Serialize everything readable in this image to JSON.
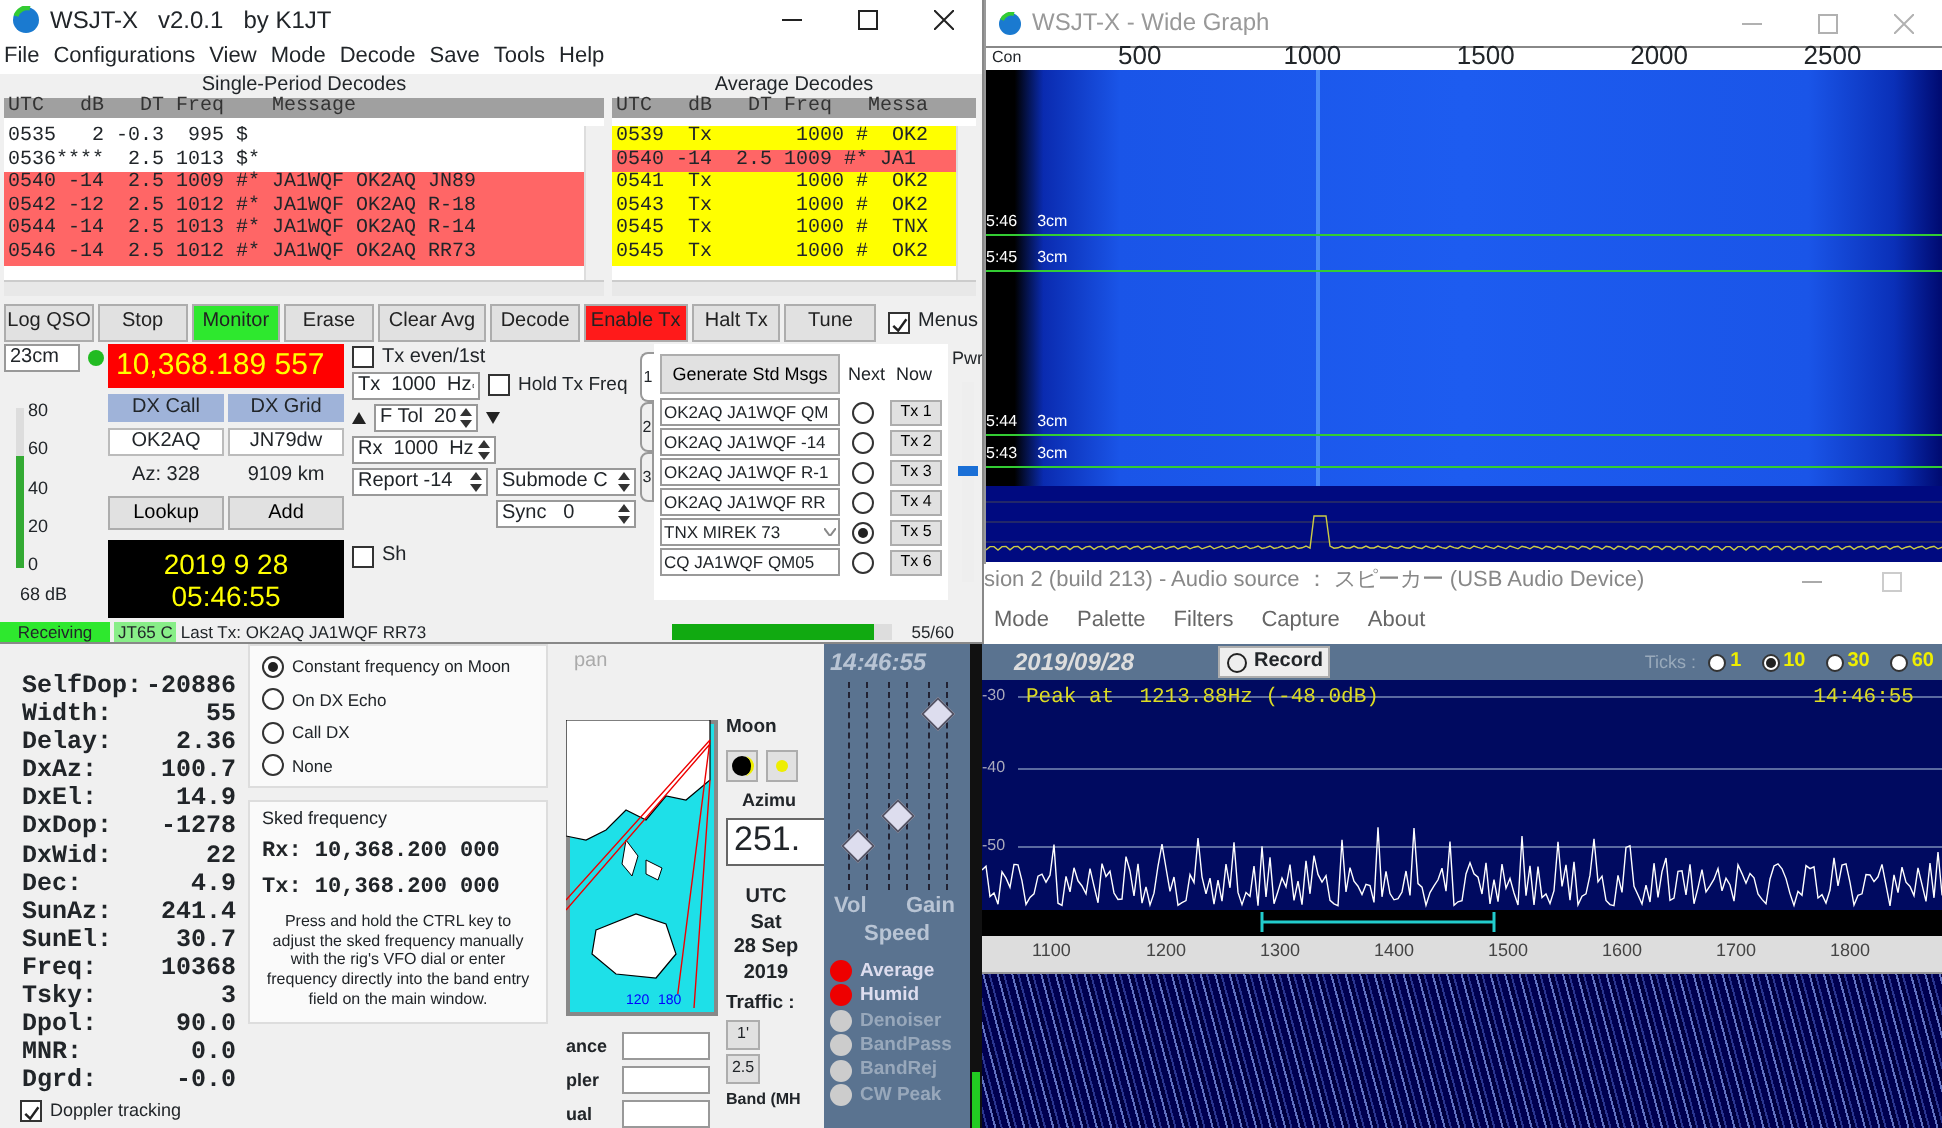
{
  "main_window": {
    "title": "WSJT-X   v2.0.1   by K1JT",
    "menu": [
      "File",
      "Configurations",
      "View",
      "Mode",
      "Decode",
      "Save",
      "Tools",
      "Help"
    ],
    "single_period": {
      "heading": "Single-Period Decodes",
      "header": "UTC   dB   DT Freq    Message",
      "rows": [
        {
          "text": "0535   2 -0.3  995 $",
          "color": "#ffffff"
        },
        {
          "text": "0536****  2.5 1013 $*",
          "color": "#ffffff"
        },
        {
          "text": "0540 -14  2.5 1009 #* JA1WQF OK2AQ JN89",
          "color": "#ff6666"
        },
        {
          "text": "0542 -12  2.5 1012 #* JA1WQF OK2AQ R-18",
          "color": "#ff6666"
        },
        {
          "text": "0544 -14  2.5 1013 #* JA1WQF OK2AQ R-14",
          "color": "#ff6666"
        },
        {
          "text": "0546 -14  2.5 1012 #* JA1WQF OK2AQ RR73",
          "color": "#ff6666"
        }
      ]
    },
    "average": {
      "heading": "Average Decodes",
      "header": "UTC   dB   DT Freq   Messa",
      "rows": [
        {
          "text": "0539  Tx       1000 #  OK2",
          "color": "#ffff00"
        },
        {
          "text": "0540 -14  2.5 1009 #* JA1",
          "color": "#ff6666"
        },
        {
          "text": "0541  Tx       1000 #  OK2",
          "color": "#ffff00"
        },
        {
          "text": "0543  Tx       1000 #  OK2",
          "color": "#ffff00"
        },
        {
          "text": "0545  Tx       1000 #  TNX",
          "color": "#ffff00"
        },
        {
          "text": "0545  Tx       1000 #  OK2",
          "color": "#ffff00"
        }
      ]
    },
    "buttons": [
      {
        "label": "Log QSO",
        "on": false
      },
      {
        "label": "Stop",
        "on": false
      },
      {
        "label": "Monitor",
        "on": true,
        "color": "#2ee82e"
      },
      {
        "label": "Erase",
        "on": false
      },
      {
        "label": "Clear Avg",
        "on": false
      },
      {
        "label": "Decode",
        "on": false
      },
      {
        "label": "Enable Tx",
        "on": true,
        "color": "#ff1a1a"
      },
      {
        "label": "Halt Tx",
        "on": false
      },
      {
        "label": "Tune",
        "on": false
      }
    ],
    "menus_toggle": {
      "label": "Menus",
      "checked": true
    },
    "band": "23cm",
    "frequency": "10,368.189 557",
    "meter": {
      "labels": [
        "80",
        "60",
        "40",
        "20",
        "0"
      ],
      "level": 0.7,
      "reading": "68 dB"
    },
    "dx_call_label": "DX Call",
    "dx_grid_label": "DX Grid",
    "dx_call": "OK2AQ",
    "dx_grid": "JN79dw",
    "azimuth": "Az: 328",
    "distance": "9109 km",
    "lookup": "Lookup",
    "add": "Add",
    "date": "2019 9 28",
    "time": "05:46:55",
    "tx_even": {
      "label": "Tx even/1st",
      "checked": false
    },
    "tx_spin": "Tx  1000  Hz",
    "hold_tx": {
      "label": "Hold Tx Freq",
      "checked": false
    },
    "ftol_spin": "F Tol  20",
    "rx_spin": "Rx  1000  Hz",
    "report_spin": "Report -14",
    "submode_spin": "Submode C",
    "sync_spin": "Sync   0",
    "sh": {
      "label": "Sh",
      "checked": false
    },
    "tabs": [
      {
        "label": "1",
        "selected": true
      },
      {
        "label": "2",
        "selected": false
      },
      {
        "label": "3",
        "selected": false
      }
    ],
    "generate": "Generate Std Msgs",
    "next_label": "Next",
    "now_label": "Now",
    "messages": [
      {
        "text": "OK2AQ JA1WQF QM",
        "kind": "field",
        "selected": false,
        "button": "Tx 1"
      },
      {
        "text": "OK2AQ JA1WQF -14",
        "kind": "field",
        "selected": false,
        "button": "Tx 2"
      },
      {
        "text": "OK2AQ JA1WQF R-1",
        "kind": "field",
        "selected": false,
        "button": "Tx 3"
      },
      {
        "text": "OK2AQ JA1WQF RR",
        "kind": "field",
        "selected": false,
        "button": "Tx 4"
      },
      {
        "text": "TNX MIREK 73",
        "kind": "combo",
        "selected": true,
        "button": "Tx 5"
      },
      {
        "text": "CQ JA1WQF QM05",
        "kind": "field",
        "selected": false,
        "button": "Tx 6"
      }
    ],
    "power": {
      "label": "Pwr",
      "level": 0.55
    },
    "status": {
      "state": "Receiving",
      "mode": "JT65 C",
      "last_tx": "Last Tx: OK2AQ JA1WQF RR73",
      "level": 0.917,
      "progress": "55/60"
    }
  },
  "wide_graph": {
    "title": "WSJT-X - Wide Graph",
    "scale_label": "Con",
    "ticks": [
      "500",
      "1000",
      "1500",
      "2000",
      "2500"
    ],
    "time_marks": [
      {
        "time": "5:46",
        "band": "3cm"
      },
      {
        "time": "5:45",
        "band": "3cm"
      },
      {
        "time": "5:44",
        "band": "3cm"
      },
      {
        "time": "5:43",
        "band": "3cm"
      }
    ]
  },
  "astro": {
    "rows": [
      {
        "label": "SelfDop:",
        "value": "-20886"
      },
      {
        "label": "Width:",
        "value": "55"
      },
      {
        "label": "Delay:",
        "value": "2.36"
      },
      {
        "label": "DxAz:",
        "value": "100.7"
      },
      {
        "label": "DxEl:",
        "value": "14.9"
      },
      {
        "label": "DxDop:",
        "value": "-1278"
      },
      {
        "label": "DxWid:",
        "value": "22"
      },
      {
        "label": "Dec:",
        "value": "4.9"
      },
      {
        "label": "SunAz:",
        "value": "241.4"
      },
      {
        "label": "SunEl:",
        "value": "30.7"
      },
      {
        "label": "Freq:",
        "value": "10368"
      },
      {
        "label": "Tsky:",
        "value": "3"
      },
      {
        "label": "Dpol:",
        "value": "90.0"
      },
      {
        "label": "MNR:",
        "value": "0.0"
      },
      {
        "label": "Dgrd:",
        "value": "-0.0"
      }
    ],
    "options": [
      {
        "label": "Constant frequency on Moon",
        "selected": true
      },
      {
        "label": "On DX Echo",
        "selected": false
      },
      {
        "label": "Call DX",
        "selected": false
      },
      {
        "label": "None",
        "selected": false
      }
    ],
    "sked_heading": "Sked frequency",
    "sked_rx": "Rx: 10,368.200 000",
    "sked_tx": "Tx: 10,368.200 000",
    "sked_note": "Press and hold the CTRL key to adjust the sked frequency manually with the rig's VFO dial or enter frequency directly into the band entry field on the main window.",
    "doppler": {
      "label": "Doppler tracking",
      "checked": true
    }
  },
  "moon_window": {
    "caption": "pan",
    "map_labels": [
      "120",
      "180"
    ],
    "moon_heading": "Moon",
    "azimuth_label": "Azimu",
    "azimuth": "251.",
    "utc_heading": "UTC",
    "day": "Sat",
    "date": "28 Sep",
    "year": "2019",
    "traffic": "Traffic :",
    "traffic_buttons": [
      "1'",
      "2.5"
    ],
    "field_labels": [
      "ance",
      "pler",
      "ual"
    ],
    "band_label": "Band (MH"
  },
  "spectrum_app": {
    "title": "sion 2  (build 213) - Audio source ： スピーカー (USB Audio Device)",
    "menu": [
      "Mode",
      "Palette",
      "Filters",
      "Capture",
      "About"
    ],
    "clock": "14:46:55",
    "sliders": [
      {
        "label": "Vol",
        "level": 0.22
      },
      {
        "label": "Speed",
        "level": 0.36
      },
      {
        "label": "Gain",
        "level": 0.85
      }
    ],
    "leds": [
      {
        "label": "Average",
        "on": true
      },
      {
        "label": "Humid",
        "on": true
      },
      {
        "label": "Denoiser",
        "on": false
      },
      {
        "label": "BandPass",
        "on": false
      },
      {
        "label": "BandRej",
        "on": false
      },
      {
        "label": "CW Peak",
        "on": false
      }
    ],
    "date": "2019/09/28",
    "record": "Record",
    "ticks_label": "Ticks :",
    "tick_options": [
      {
        "label": "1",
        "selected": false
      },
      {
        "label": "10",
        "selected": true
      },
      {
        "label": "30",
        "selected": false
      },
      {
        "label": "60",
        "selected": false
      }
    ],
    "peak": "Peak at  1213.88Hz (-48.0dB)",
    "plot_time": "14:46:55",
    "y_labels": [
      "-30",
      "-40",
      "-50"
    ],
    "x_labels": [
      "1100",
      "1200",
      "1300",
      "1400",
      "1500",
      "1600",
      "1700",
      "1800"
    ]
  }
}
